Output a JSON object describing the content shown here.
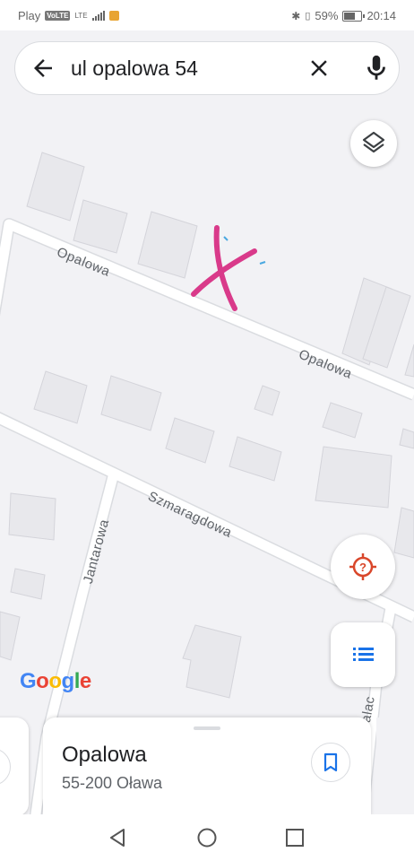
{
  "status_bar": {
    "carrier": "Play",
    "volte": "VoLTE",
    "network": "LTE",
    "battery_percent": "59%",
    "time": "20:14"
  },
  "search": {
    "query": "ul opalowa 54"
  },
  "map": {
    "street_labels": {
      "opalowa_1": "Opalowa",
      "opalowa_2": "Opalowa",
      "szmaragdowa": "Szmaragdowa",
      "jantarowa": "Jantarowa",
      "edge_label": "alac"
    },
    "logo_letters": [
      "G",
      "o",
      "o",
      "g",
      "l",
      "e"
    ],
    "logo_colors": [
      "#4285f4",
      "#ea4335",
      "#fbbc05",
      "#4285f4",
      "#34a853",
      "#ea4335"
    ],
    "annotation_color": "#d93a8a"
  },
  "place": {
    "name": "Opalowa",
    "address": "55-200 Oława"
  },
  "icons": {
    "back": "arrow-back-icon",
    "clear": "close-icon",
    "mic": "mic-icon",
    "layers": "layers-icon",
    "locate": "location-unknown-icon",
    "list": "list-icon",
    "save": "bookmark-icon",
    "nav_back": "triangle-back-icon",
    "nav_home": "circle-home-icon",
    "nav_recent": "square-recent-icon"
  },
  "colors": {
    "accent_blue": "#1a73e8",
    "locate_red": "#d9472b",
    "road": "#ffffff",
    "road_edge": "#dadce0",
    "building": "#e8e8ec"
  }
}
